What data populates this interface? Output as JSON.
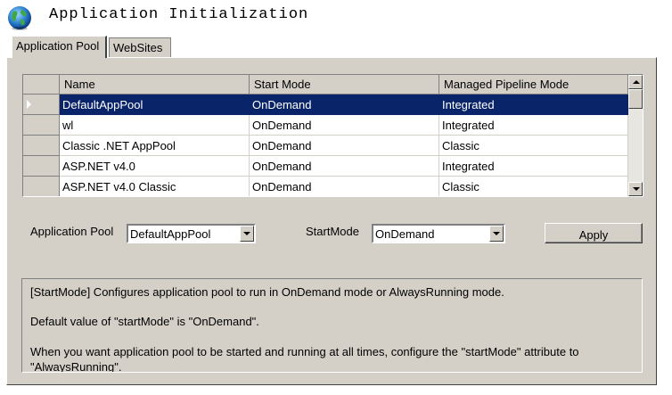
{
  "window": {
    "title": "Application Initialization"
  },
  "tabs": [
    {
      "label": "Application Pool",
      "active": true
    },
    {
      "label": "WebSites",
      "active": false
    }
  ],
  "grid": {
    "columns": [
      "Name",
      "Start Mode",
      "Managed Pipeline Mode"
    ],
    "rows": [
      {
        "name": "DefaultAppPool",
        "start_mode": "OnDemand",
        "pipeline": "Integrated",
        "selected": true
      },
      {
        "name": "wl",
        "start_mode": "OnDemand",
        "pipeline": "Integrated"
      },
      {
        "name": "Classic .NET AppPool",
        "start_mode": "OnDemand",
        "pipeline": "Classic"
      },
      {
        "name": "ASP.NET v4.0",
        "start_mode": "OnDemand",
        "pipeline": "Integrated"
      },
      {
        "name": "ASP.NET v4.0 Classic",
        "start_mode": "OnDemand",
        "pipeline": "Classic"
      }
    ]
  },
  "form": {
    "app_pool_label": "Application Pool",
    "app_pool_value": "DefaultAppPool",
    "start_mode_label": "StartMode",
    "start_mode_value": "OnDemand",
    "apply_label": "Apply"
  },
  "description": {
    "line1": "[StartMode] Configures application pool to run in OnDemand mode or AlwaysRunning mode.",
    "line2": "Default value of \"startMode\" is \"OnDemand\".",
    "line3": "When you want application pool to be started and running at all times, configure the \"startMode\" attribute to \"AlwaysRunning\"."
  },
  "colors": {
    "selection": "#0a246a",
    "chrome": "#d4d0c8"
  },
  "icons": {
    "app": "globe-icon"
  }
}
